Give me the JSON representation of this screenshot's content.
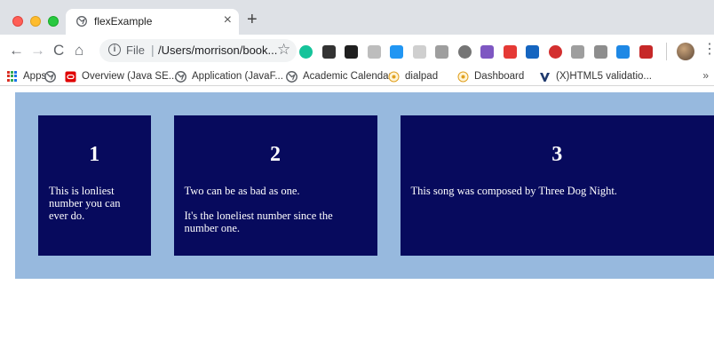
{
  "browser": {
    "tab": {
      "title": "flexExample",
      "close_glyph": "×",
      "favicon": "globe-icon"
    },
    "new_tab_glyph": "+",
    "toolbar": {
      "back_glyph": "←",
      "forward_glyph": "→",
      "reload_glyph": "C",
      "home_glyph": "⌂",
      "address": {
        "prefix": "File",
        "separator": "|",
        "url": "/Users/morrison/book..."
      },
      "star_glyph": "☆",
      "menu_glyph": "⋮"
    },
    "extensions": [
      {
        "name": "grammarly-icon",
        "color": "#15c39a"
      },
      {
        "name": "extension-dark-icon",
        "color": "#333333"
      },
      {
        "name": "extension-v-icon",
        "color": "#1f1f1f"
      },
      {
        "name": "shield-extension-icon",
        "color": "#bdbdbd"
      },
      {
        "name": "extension-blue-icon",
        "color": "#2196f3"
      },
      {
        "name": "extension-grey-icon",
        "color": "#cfcfcf"
      },
      {
        "name": "extension-ls-icon",
        "color": "#9e9e9e"
      },
      {
        "name": "extension-circle-icon",
        "color": "#757575"
      },
      {
        "name": "extension-pencil-icon",
        "color": "#7e57c2"
      },
      {
        "name": "extension-red-play-icon",
        "color": "#e53935"
      },
      {
        "name": "extension-blue-square-icon",
        "color": "#1565c0"
      },
      {
        "name": "extension-red-circle-icon",
        "color": "#d32f2f"
      },
      {
        "name": "extension-grey-square-icon",
        "color": "#9e9e9e"
      },
      {
        "name": "extension-n-icon",
        "color": "#8d8d8d"
      },
      {
        "name": "extension-s-icon",
        "color": "#1e88e5"
      },
      {
        "name": "extension-red-box-icon",
        "color": "#c62828"
      }
    ]
  },
  "bookmarks": {
    "items": [
      {
        "label": "Apps",
        "icon": "apps-grid-icon"
      },
      {
        "label": "",
        "icon": "globe-icon"
      },
      {
        "label": "Overview (Java SE...",
        "icon": "oracle-icon"
      },
      {
        "label": "Application (JavaF...",
        "icon": "globe-icon"
      },
      {
        "label": "Academic Calendar",
        "icon": "globe-icon"
      },
      {
        "label": "dialpad",
        "icon": "dialpad-icon"
      },
      {
        "label": "Dashboard",
        "icon": "dashboard-icon"
      },
      {
        "label": "(X)HTML5 validatio...",
        "icon": "validator-icon"
      }
    ],
    "more_glyph": "»"
  },
  "content": {
    "items": [
      {
        "number": "1",
        "paragraphs": [
          "This is lonliest number you can ever do."
        ]
      },
      {
        "number": "2",
        "paragraphs": [
          "Two can be as bad as one.",
          "It's the loneliest number since the number one."
        ]
      },
      {
        "number": "3",
        "paragraphs": [
          "This song was composed by Three Dog Night."
        ]
      }
    ]
  },
  "colors": {
    "container_bg": "#97b9de",
    "item_bg": "#070a5d",
    "item_text": "#ffffff"
  }
}
